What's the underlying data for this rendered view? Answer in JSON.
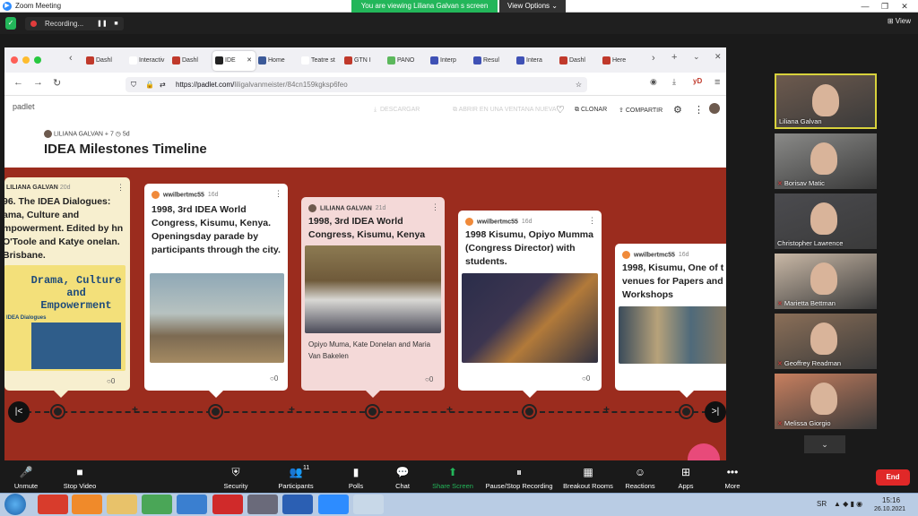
{
  "zoom": {
    "app_title": "Zoom Meeting",
    "viewing_banner": "You are viewing Liliana Galvan s screen",
    "view_options": "View Options",
    "recording": "Recording...",
    "view_label": "View",
    "window_controls": [
      "—",
      "❐",
      "✕"
    ]
  },
  "browser": {
    "tabs": [
      {
        "label": "Dashl",
        "color": "#c0392b"
      },
      {
        "label": "Interactiv",
        "color": "#ffffff"
      },
      {
        "label": "Dashl",
        "color": "#c0392b"
      },
      {
        "label": "IDE",
        "color": "#222222",
        "active": true,
        "close": "✕"
      },
      {
        "label": "Home",
        "color": "#3b5998"
      },
      {
        "label": "Teatre st",
        "color": "#ffffff"
      },
      {
        "label": "GTN I",
        "color": "#c0392b"
      },
      {
        "label": "PANO",
        "color": "#5cb85c"
      },
      {
        "label": "Interp",
        "color": "#3f51b5"
      },
      {
        "label": "Resul",
        "color": "#3f51b5"
      },
      {
        "label": "Intera",
        "color": "#3f51b5"
      },
      {
        "label": "Dashl",
        "color": "#c0392b"
      },
      {
        "label": "Here",
        "color": "#c0392b"
      }
    ],
    "url_prefix": "https://padlet.com/",
    "url_rest": "liligalvanmeister/84cn159kgksp6feo",
    "ext_label": "yD"
  },
  "padlet": {
    "logo": "padlet",
    "descargar": "DESCARGAR",
    "abrir": "ABRIR EN UNA VENTANA NUEVA",
    "clonar": "CLONAR",
    "compartir": "COMPARTIR",
    "author": "LILIANA GALVAN",
    "meta_plus": "+ 7",
    "meta_age": "5d",
    "title": "IDEA Milestones Timeline",
    "cards": [
      {
        "author": "LILIANA GALVAN",
        "age": "20d",
        "text": "96. The IDEA Dialogues: ama, Culture and mpowerment. Edited by hn O'Toole and Katye onelan. Brisbane.",
        "book_title": "Drama, Culture and Empowerment",
        "book_sub": "IDEA Dialogues",
        "comments": "0"
      },
      {
        "author": "wwilbertmc55",
        "age": "16d",
        "text": "1998, 3rd IDEA World Congress, Kisumu, Kenya. Openingsday parade by participants through the city.",
        "comments": "0"
      },
      {
        "author": "LILIANA GALVAN",
        "age": "21d",
        "text": "1998, 3rd IDEA World Congress, Kisumu, Kenya",
        "caption": "Opiyo Muma, Kate Donelan and Maria Van Bakelen",
        "comments": "0"
      },
      {
        "author": "wwilbertmc55",
        "age": "16d",
        "text": "1998 Kisumu, Opiyo Mumma (Congress Director) with students.",
        "comments": "0"
      },
      {
        "author": "wwilbertmc55",
        "age": "16d",
        "text": "1998, Kisumu, One of t venues for Papers and Workshops",
        "comments": ""
      }
    ]
  },
  "participants": [
    {
      "name": "Liliana Galvan",
      "bg": "#6d5a4e",
      "muted": false
    },
    {
      "name": "Borisav Matic",
      "bg": "#8a8a88",
      "muted": true
    },
    {
      "name": "Christopher Lawrence",
      "bg": "#4b4b4f",
      "muted": false
    },
    {
      "name": "Marietta Bettman",
      "bg": "#c9b8a6",
      "muted": true
    },
    {
      "name": "Geoffrey Readman",
      "bg": "#8b6f58",
      "muted": true
    },
    {
      "name": "Melissa Giorgio",
      "bg": "#c77f5f",
      "muted": true
    }
  ],
  "toolbar": [
    {
      "label": "Unmute",
      "icon": "🎤"
    },
    {
      "label": "Stop Video",
      "icon": "■"
    },
    {
      "label": "Security",
      "icon": "⛨"
    },
    {
      "label": "Participants",
      "icon": "👥",
      "count": "11"
    },
    {
      "label": "Polls",
      "icon": "▮"
    },
    {
      "label": "Chat",
      "icon": "💬"
    },
    {
      "label": "Share Screen",
      "icon": "⬆"
    },
    {
      "label": "Pause/Stop Recording",
      "icon": "⏸"
    },
    {
      "label": "Breakout Rooms",
      "icon": "▦"
    },
    {
      "label": "Reactions",
      "icon": "☺"
    },
    {
      "label": "Apps",
      "icon": "⊞"
    },
    {
      "label": "More",
      "icon": "•••"
    }
  ],
  "end_label": "End",
  "taskbar": {
    "lang": "SR",
    "time": "15:16",
    "date": "26.10.2021"
  }
}
